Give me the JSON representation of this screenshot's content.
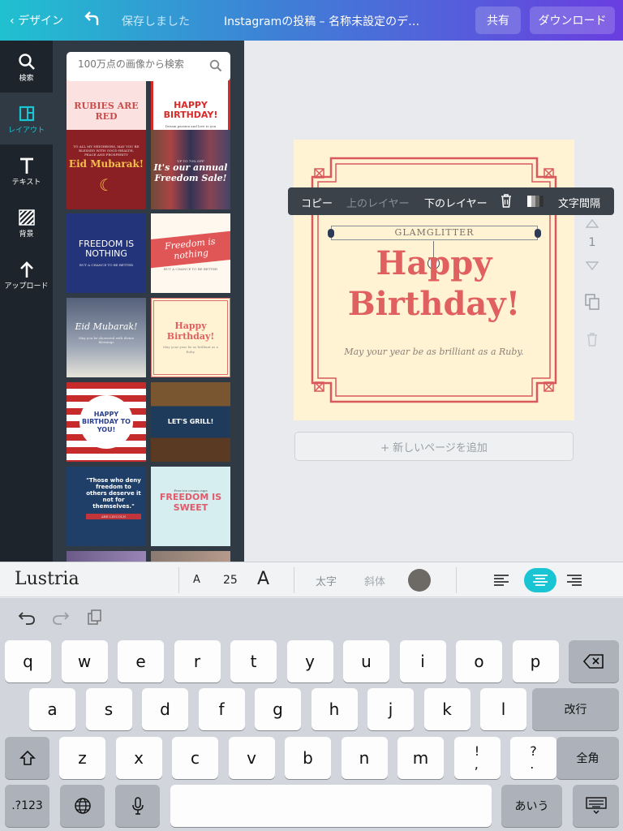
{
  "topbar": {
    "back_label": "デザイン",
    "saved_status": "保存しました",
    "doc_title": "Instagramの投稿 – 名称未設定のデ…",
    "share_label": "共有",
    "download_label": "ダウンロード",
    "gradient_colors": [
      "#20c1d0",
      "#3f7fd6",
      "#6a3ee0"
    ]
  },
  "sidebar": {
    "items": [
      {
        "label": "検索",
        "icon": "search-icon"
      },
      {
        "label": "レイアウト",
        "icon": "layout-icon",
        "active": true
      },
      {
        "label": "テキスト",
        "icon": "text-icon"
      },
      {
        "label": "背景",
        "icon": "background-icon"
      },
      {
        "label": "アップロード",
        "icon": "upload-icon"
      }
    ],
    "accent": "#19c5d3"
  },
  "panel": {
    "search_placeholder": "100万点の画像から検索",
    "templates": [
      {
        "title": "RUBIES ARE RED"
      },
      {
        "title": "HAPPY BIRTHDAY!",
        "subtitle": "Dream passion and love to you"
      },
      {
        "title": "Eid Mubarak!",
        "subtitle": "TO ALL MY NEIGHBORS, MAY YOU BE BLESSED WITH GOOD HEALTH, PEACE AND PROSPERITY"
      },
      {
        "title": "It's our annual Freedom Sale!",
        "subtitle": "UP TO 70% OFF"
      },
      {
        "title": "FREEDOM IS NOTHING",
        "subtitle": "BUT A CHANCE TO BE BETTER"
      },
      {
        "title": "Freedom is nothing",
        "subtitle": "BUT A CHANCE TO BE BETTER"
      },
      {
        "title": "Eid Mubarak!",
        "subtitle": "May you be showered with divine blessings"
      },
      {
        "title": "Happy Birthday!",
        "subtitle": "May your year be as brilliant as a Ruby."
      },
      {
        "title": "HAPPY BIRTHDAY TO YOU!"
      },
      {
        "title": "LET'S GRILL!"
      },
      {
        "title": "\"Those who deny freedom to others deserve it not for themselves.\"",
        "subtitle": "ABE LINCOLN"
      },
      {
        "title": "FREEDOM IS SWEET",
        "subtitle": "Free ice cream cups"
      }
    ]
  },
  "toolbar": {
    "copy": "コピー",
    "layer_up": "上のレイヤー",
    "layer_down": "下のレイヤー",
    "spacing": "文字間隔"
  },
  "design": {
    "brand": "GLAMGLITTER",
    "headline_1": "Happy",
    "headline_2": "Birthday!",
    "tagline": "May your year be as brilliant as a Ruby.",
    "background": "#fff3d4",
    "accent": "#e06060",
    "frame": "#d9595b"
  },
  "page_controls": {
    "page_number": "1"
  },
  "add_page_label": "+ 新しいページを追加",
  "format_bar": {
    "font_name": "Lustria",
    "font_size": "25",
    "size_small_label": "A",
    "size_large_label": "A",
    "bold_label": "太字",
    "italic_label": "斜体",
    "text_color": "#6d6a66",
    "alignment": "center"
  },
  "keyboard": {
    "row1": [
      "q",
      "w",
      "e",
      "r",
      "t",
      "y",
      "u",
      "i",
      "o",
      "p"
    ],
    "row2": [
      "a",
      "s",
      "d",
      "f",
      "g",
      "h",
      "j",
      "k",
      "l"
    ],
    "row3": [
      "z",
      "x",
      "c",
      "v",
      "b",
      "n",
      "m",
      "!\n,",
      "?\n."
    ],
    "return_label": "改行",
    "fullwidth_label": "全角",
    "numbers_label": ".?123",
    "kana_label": "あいう"
  }
}
